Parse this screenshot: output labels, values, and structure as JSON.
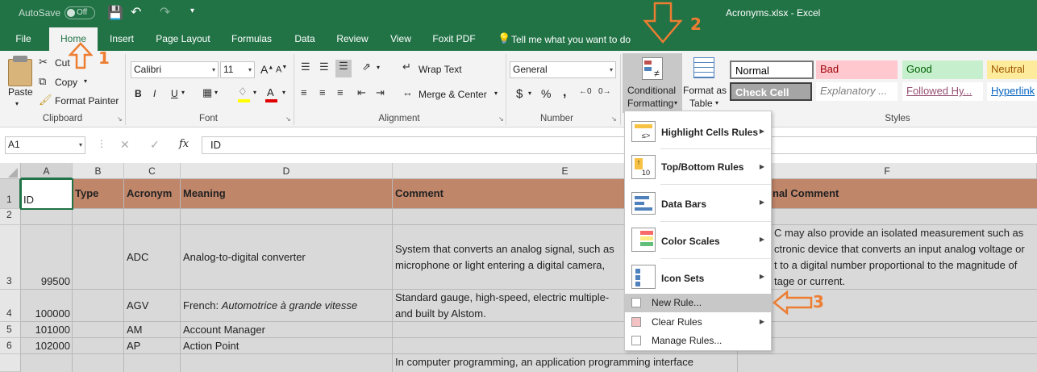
{
  "titlebar": {
    "autosave_label": "AutoSave",
    "autosave_state": "Off",
    "filename": "Acronyms.xlsx - Excel"
  },
  "tabs": [
    "File",
    "Home",
    "Insert",
    "Page Layout",
    "Formulas",
    "Data",
    "Review",
    "View",
    "Foxit PDF"
  ],
  "tell_me": "Tell me what you want to do",
  "clipboard": {
    "paste": "Paste",
    "cut": "Cut",
    "copy": "Copy",
    "format_painter": "Format Painter",
    "label": "Clipboard"
  },
  "font": {
    "name": "Calibri",
    "size": "11",
    "label": "Font",
    "bold": "B",
    "italic": "I",
    "underline": "U"
  },
  "alignment": {
    "wrap_text": "Wrap Text",
    "merge_center": "Merge & Center",
    "label": "Alignment"
  },
  "number": {
    "format": "General",
    "label": "Number",
    "currency": "$",
    "percent": "%",
    "comma": ","
  },
  "styles_group": {
    "conditional_formatting": [
      "Conditional",
      "Formatting"
    ],
    "format_as_table": [
      "Format as",
      "Table"
    ],
    "label": "Styles",
    "cells": [
      {
        "name": "Normal",
        "bg": "#ffffff",
        "fg": "#000000"
      },
      {
        "name": "Bad",
        "bg": "#ffc7ce",
        "fg": "#9c0006"
      },
      {
        "name": "Good",
        "bg": "#c6efce",
        "fg": "#006100"
      },
      {
        "name": "Neutral",
        "bg": "#ffeb9c",
        "fg": "#9c5700"
      },
      {
        "name": "Check Cell",
        "bg": "#a5a5a5",
        "fg": "#ffffff"
      },
      {
        "name": "Explanatory ...",
        "bg": "#ffffff",
        "fg": "#7f7f7f"
      },
      {
        "name": "Followed Hy...",
        "bg": "#ffffff",
        "fg": "#954f72"
      },
      {
        "name": "Hyperlink",
        "bg": "#ffffff",
        "fg": "#0563c1"
      }
    ]
  },
  "formula_bar": {
    "name_box": "A1",
    "fx": "fx",
    "content": "ID"
  },
  "columns": [
    "A",
    "B",
    "C",
    "D",
    "E",
    "F"
  ],
  "rows": [
    "1",
    "2",
    "3",
    "4",
    "5",
    "6"
  ],
  "header_row": [
    "ID",
    "Type",
    "Acronym",
    "Meaning",
    "Comment",
    "nal Comment"
  ],
  "data": [
    {
      "id": "99500",
      "acronym": "ADC",
      "meaning": "Analog-to-digital converter",
      "comment": [
        "System that converts an analog signal, such as",
        "microphone or light entering a digital camera,"
      ],
      "extra": [
        "C may also provide an isolated measurement such as",
        "ctronic device that converts an input analog voltage or",
        "t to a digital number proportional to the magnitude of",
        "tage or current."
      ]
    },
    {
      "id": "100000",
      "acronym": "AGV",
      "meaning_prefix": "French: ",
      "meaning_italic": "Automotrice à grande vitesse",
      "comment": [
        "Standard gauge, high-speed, electric multiple-",
        "and built by Alstom."
      ]
    },
    {
      "id": "101000",
      "acronym": "AM",
      "meaning": "Account Manager"
    },
    {
      "id": "102000",
      "acronym": "AP",
      "meaning": "Action Point"
    },
    {
      "comment": [
        "In computer programming, an application programming interface"
      ]
    }
  ],
  "cf_menu": {
    "items": [
      "Highlight Cells Rules",
      "Top/Bottom Rules",
      "Data Bars",
      "Color Scales",
      "Icon Sets"
    ],
    "small_items": [
      "New Rule...",
      "Clear Rules",
      "Manage Rules..."
    ]
  },
  "annotations": [
    "1",
    "2",
    "3"
  ],
  "colors": {
    "excel_green": "#217346",
    "header_fill": "#c0866a",
    "annotation": "#ed7d31"
  }
}
